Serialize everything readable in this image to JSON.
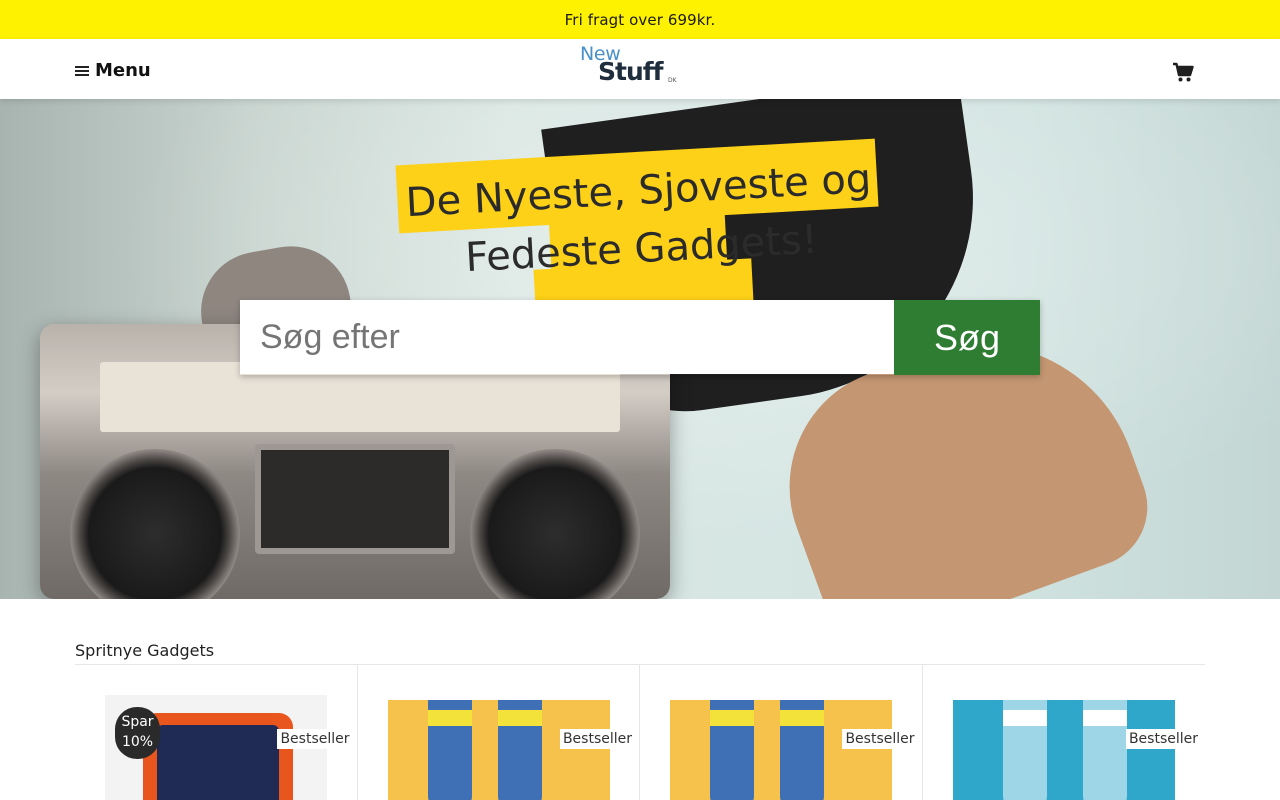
{
  "banner": {
    "text": "Fri fragt over 699kr."
  },
  "header": {
    "menu_label": "Menu",
    "logo": {
      "line1": "New",
      "line2": "Stuff",
      "suffix": "DK"
    },
    "cart_icon": "cart-icon"
  },
  "hero": {
    "headline": "De Nyeste, Sjoveste og Fedeste Gadgets!",
    "search": {
      "placeholder": "Søg efter",
      "button_label": "Søg"
    }
  },
  "section": {
    "title": "Spritnye Gadgets",
    "products": [
      {
        "badge": "Bestseller",
        "save_badge": "Spar 10%",
        "image": "solar-powerbank"
      },
      {
        "badge": "Bestseller",
        "image": "superhero-socks"
      },
      {
        "badge": "Bestseller",
        "image": "superhero-socks"
      },
      {
        "badge": "Bestseller",
        "image": "pattern-socks"
      }
    ]
  },
  "colors": {
    "banner": "#fff200",
    "search_button": "#2e7d32",
    "headline_highlight": "#fcd117"
  }
}
